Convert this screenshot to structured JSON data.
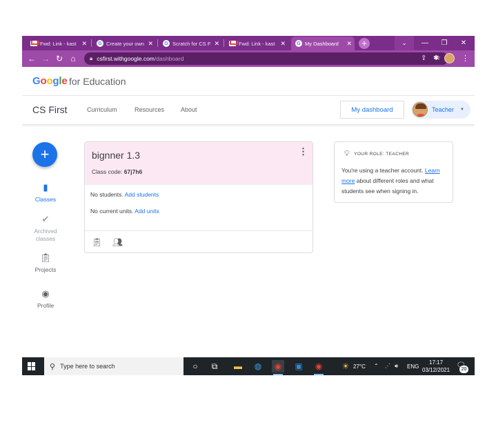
{
  "browser": {
    "tabs": [
      {
        "title": "Fwd: Link - kast",
        "favicon": "gmail-icon",
        "active": false
      },
      {
        "title": "Create your own",
        "favicon": "google-icon",
        "active": false
      },
      {
        "title": "Scratch for CS F",
        "favicon": "google-icon",
        "active": false
      },
      {
        "title": "Fwd: Link - kast",
        "favicon": "gmail-icon",
        "active": false
      },
      {
        "title": "My Dashboard",
        "favicon": "google-icon",
        "active": true
      }
    ],
    "url_host": "csfirst.withgoogle.com",
    "url_path": "/dashboard",
    "theme_color": "#7b2d8a"
  },
  "brand": {
    "google_letters": [
      "G",
      "o",
      "o",
      "g",
      "l",
      "e"
    ],
    "product": "for Education"
  },
  "nav": {
    "site_title": "CS First",
    "links": [
      "Curriculum",
      "Resources",
      "About"
    ],
    "dashboard_button": "My dashboard",
    "user_role": "Teacher"
  },
  "sidebar": {
    "add_button": "+",
    "items": [
      {
        "label": "Classes",
        "icon": "class-book-icon",
        "state": "active"
      },
      {
        "label": "Archived classes",
        "icon": "check-icon",
        "state": "muted"
      },
      {
        "label": "Projects",
        "icon": "clipboard-icon",
        "state": "normal"
      },
      {
        "label": "Profile",
        "icon": "profile-icon",
        "state": "normal"
      }
    ]
  },
  "class_card": {
    "name": "bignner 1.3",
    "code_label": "Class code:",
    "code_value": "67j7h6",
    "students_text": "No students.",
    "students_link": "Add students",
    "units_text": "No current units.",
    "units_link": "Add units",
    "header_color": "#fce8f2"
  },
  "role_box": {
    "heading": "YOUR ROLE: TEACHER",
    "text_1": "You're using a teacher account.",
    "link": "Learn more",
    "text_2": "about different roles and what students see when signing in."
  },
  "taskbar": {
    "search_placeholder": "Type here to search",
    "temperature": "27°C",
    "language": "ENG",
    "time": "17:17",
    "date": "03/12/2021",
    "notifications": "20"
  }
}
